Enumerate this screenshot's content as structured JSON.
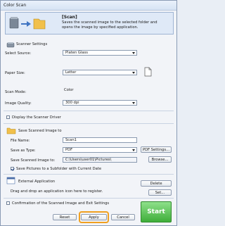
{
  "window": {
    "title": "Color Scan"
  },
  "header": {
    "title": "[Scan]",
    "description": "Saves the scanned image to the selected folder and opens the image by specified application."
  },
  "scanner_settings": {
    "heading": "Scanner Settings",
    "select_source_label": "Select Source:",
    "select_source_value": "Platen Glass",
    "paper_size_label": "Paper Size:",
    "paper_size_value": "Letter",
    "scan_mode_label": "Scan Mode:",
    "scan_mode_value": "Color",
    "image_quality_label": "Image Quality:",
    "image_quality_value": "300 dpi"
  },
  "display_driver": {
    "label": "Display the Scanner Driver",
    "checked": false
  },
  "save_image": {
    "heading": "Save Scanned Image to",
    "file_name_label": "File Name:",
    "file_name_value": "Scan1",
    "save_type_label": "Save as Type:",
    "save_type_value": "PDF",
    "pdf_settings_button": "PDF Settings...",
    "save_to_label": "Save Scanned Image to:",
    "save_to_value": "C:\\Users\\user01\\Pictures\\",
    "browse_button": "Browse...",
    "subfolder_label": "Save Pictures to a Subfolder with Current Date",
    "subfolder_checked": true
  },
  "external_app": {
    "heading": "External Application",
    "instruction": "Drag and drop an application icon here to register.",
    "delete_button": "Delete",
    "set_button": "Set..."
  },
  "confirmation": {
    "label": "Confirmation of the Scanned Image and Exit Settings",
    "checked": false
  },
  "footer": {
    "reset": "Reset",
    "apply": "Apply",
    "cancel": "Cancel",
    "start": "Start"
  },
  "colors": {
    "accent": "#f0a020",
    "start_green": "#3fae3a",
    "header_blue": "#dfe9f7"
  }
}
